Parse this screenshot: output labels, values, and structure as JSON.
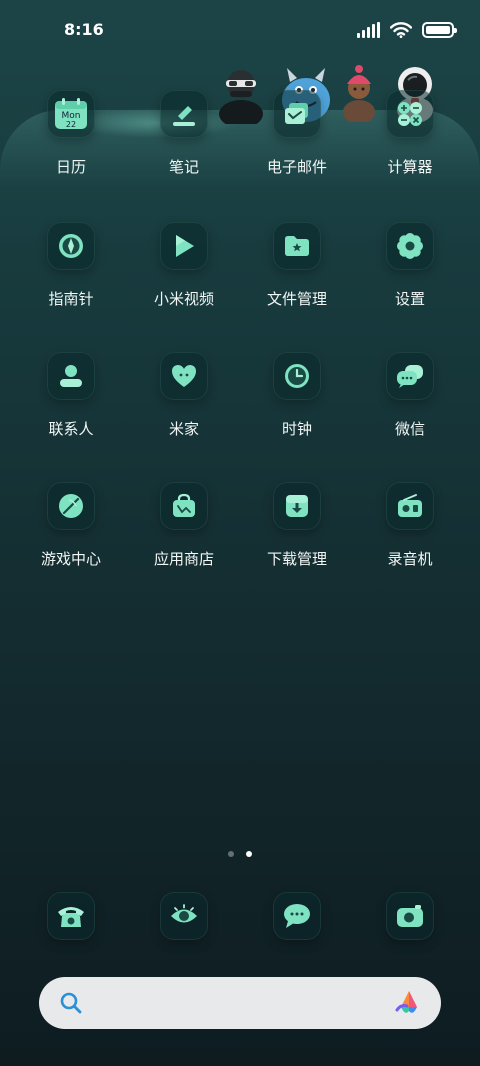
{
  "status_bar": {
    "time": "8:16",
    "signal_icon": "cellular-signal-icon",
    "wifi_icon": "wifi-icon",
    "battery_icon": "battery-icon",
    "battery_level": 1.0
  },
  "calendar_widget": {
    "weekday": "Mon",
    "day": "22"
  },
  "apps": [
    {
      "label": "日历",
      "icon": "calendar-icon"
    },
    {
      "label": "笔记",
      "icon": "notes-icon"
    },
    {
      "label": "电子邮件",
      "icon": "email-icon"
    },
    {
      "label": "计算器",
      "icon": "calculator-icon"
    },
    {
      "label": "指南针",
      "icon": "compass-icon"
    },
    {
      "label": "小米视频",
      "icon": "video-play-icon"
    },
    {
      "label": "文件管理",
      "icon": "folder-icon"
    },
    {
      "label": "设置",
      "icon": "gear-icon"
    },
    {
      "label": "联系人",
      "icon": "contacts-icon"
    },
    {
      "label": "米家",
      "icon": "heart-home-icon"
    },
    {
      "label": "时钟",
      "icon": "clock-icon"
    },
    {
      "label": "微信",
      "icon": "chat-bubbles-icon"
    },
    {
      "label": "游戏中心",
      "icon": "game-center-icon"
    },
    {
      "label": "应用商店",
      "icon": "shopping-bag-icon"
    },
    {
      "label": "下载管理",
      "icon": "download-tray-icon"
    },
    {
      "label": "录音机",
      "icon": "radio-recorder-icon"
    }
  ],
  "dock": [
    {
      "icon": "phone-icon"
    },
    {
      "icon": "browser-eye-icon"
    },
    {
      "icon": "messages-icon"
    },
    {
      "icon": "camera-icon"
    }
  ],
  "pagination": {
    "pages": 2,
    "current": 2
  },
  "search_bar": {
    "search_icon": "search-icon",
    "assistant_icon": "ai-assistant-icon"
  },
  "colors": {
    "accent": "#7FE3C2",
    "accent_light": "#A8F0D6",
    "background_top": "#1c4446",
    "background_bottom": "#0e1c20",
    "search_bg": "#e7e9ea"
  }
}
